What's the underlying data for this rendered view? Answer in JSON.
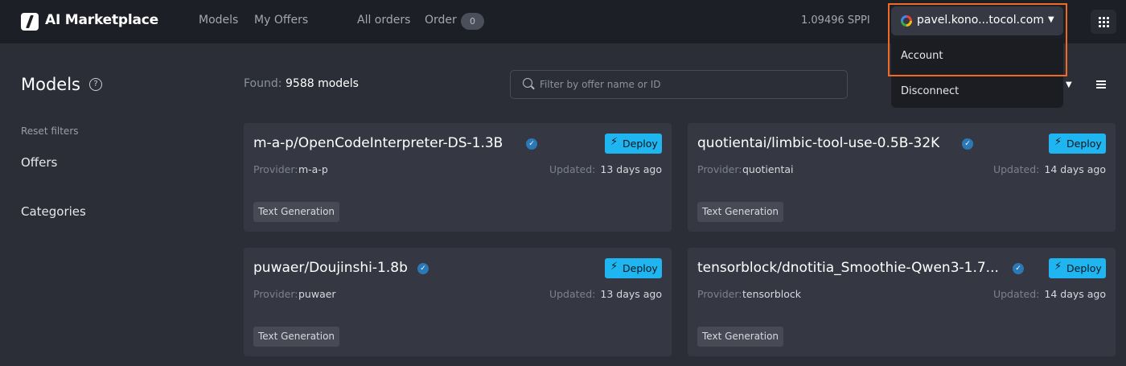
{
  "header": {
    "brand": "AI Marketplace",
    "nav": [
      "Models",
      "My Offers",
      "All orders",
      "Order"
    ],
    "order_count": "0",
    "balance": "1.09496 SPPI",
    "account_label": "pavel.kono...tocol.com"
  },
  "dropdown": {
    "items": [
      "Account",
      "Disconnect"
    ]
  },
  "sidebar": {
    "title": "Models",
    "reset_filters": "Reset filters",
    "sections": [
      "Offers",
      "Categories"
    ]
  },
  "toolbar": {
    "found_label": "Found:",
    "found_count": "9588 models",
    "search_placeholder": "Filter by offer name or ID"
  },
  "card_labels": {
    "deploy": "Deploy",
    "provider": "Provider:",
    "updated": "Updated:"
  },
  "cards": [
    {
      "title": "m-a-p/OpenCodeInterpreter-DS-1.3B",
      "provider": "m-a-p",
      "updated": "13 days ago",
      "tag": "Text Generation"
    },
    {
      "title": "quotientai/limbic-tool-use-0.5B-32K",
      "provider": "quotientai",
      "updated": "14 days ago",
      "tag": "Text Generation"
    },
    {
      "title": "puwaer/Doujinshi-1.8b",
      "provider": "puwaer",
      "updated": "13 days ago",
      "tag": "Text Generation"
    },
    {
      "title": "tensorblock/dnotitia_Smoothie-Qwen3-1.7...",
      "provider": "tensorblock",
      "updated": "14 days ago",
      "tag": "Text Generation"
    }
  ],
  "colors": {
    "accent": "#1fb5f0",
    "highlight": "#f06a24",
    "background": "#2b2e37",
    "header": "#1d1f26",
    "card": "#353843"
  }
}
